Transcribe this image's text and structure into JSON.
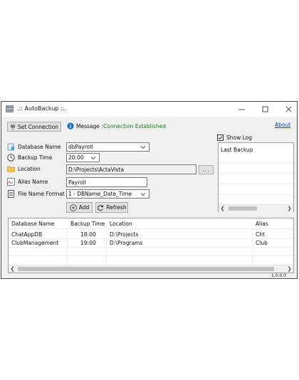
{
  "window": {
    "title": ".:: AutoBackup ::.",
    "version": "1.0.0.0"
  },
  "toolbar": {
    "set_connection_label": "Set Connection",
    "message_label": "Message :",
    "message_value": "Connection Established",
    "about_label": "About"
  },
  "form": {
    "database_name": {
      "label": "Database Name",
      "value": "dbPayroll"
    },
    "backup_time": {
      "label": "Backup Time",
      "value": "20:00"
    },
    "location": {
      "label": "Location",
      "value": "D:\\Projects\\ActaVista",
      "browse_label": "..."
    },
    "alias_name": {
      "label": "Alias Name",
      "value": "Payroll"
    },
    "file_name_format": {
      "label": "File Name Format",
      "value": "1 - DBName_Date_Time"
    },
    "add_label": "Add",
    "refresh_label": "Refresh"
  },
  "log": {
    "show_log_label": "Show Log",
    "show_log_checked": true,
    "lines": [
      "Last Backup"
    ]
  },
  "table": {
    "columns": [
      "Database Name",
      "Backup Time",
      "Location",
      "Alias"
    ],
    "rows": [
      [
        "ChatAppDB",
        "18:00",
        "D:\\Projects",
        "Cht"
      ],
      [
        "ClubManagement",
        "19:00",
        "D:\\Programs",
        "Club"
      ]
    ]
  },
  "colors": {
    "message": "#1a7f1a",
    "link": "#0645ad",
    "window_bg": "#f0f0f0"
  }
}
